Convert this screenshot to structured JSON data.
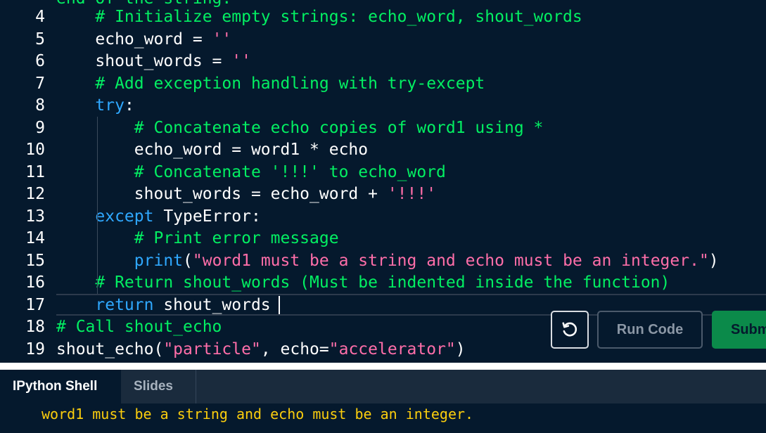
{
  "editor": {
    "partial_top_line": "end of the string.",
    "lines": [
      {
        "num": "4",
        "segs": [
          {
            "t": "    ",
            "c": "pl"
          },
          {
            "t": "# Initialize empty strings: echo_word, shout_words",
            "c": "cm"
          }
        ]
      },
      {
        "num": "5",
        "segs": [
          {
            "t": "    echo_word = ",
            "c": "pl"
          },
          {
            "t": "''",
            "c": "st"
          }
        ]
      },
      {
        "num": "6",
        "segs": [
          {
            "t": "    shout_words = ",
            "c": "pl"
          },
          {
            "t": "''",
            "c": "st"
          }
        ]
      },
      {
        "num": "7",
        "segs": [
          {
            "t": "    ",
            "c": "pl"
          },
          {
            "t": "# Add exception handling with try-except",
            "c": "cm"
          }
        ]
      },
      {
        "num": "8",
        "segs": [
          {
            "t": "    ",
            "c": "pl"
          },
          {
            "t": "try",
            "c": "kw"
          },
          {
            "t": ":",
            "c": "pl"
          }
        ]
      },
      {
        "num": "9",
        "segs": [
          {
            "t": "        ",
            "c": "pl"
          },
          {
            "t": "# Concatenate echo copies of word1 using *",
            "c": "cm"
          }
        ]
      },
      {
        "num": "10",
        "segs": [
          {
            "t": "        echo_word = word1 * echo",
            "c": "pl"
          }
        ]
      },
      {
        "num": "11",
        "segs": [
          {
            "t": "        ",
            "c": "pl"
          },
          {
            "t": "# Concatenate '!!!' to echo_word",
            "c": "cm"
          }
        ]
      },
      {
        "num": "12",
        "segs": [
          {
            "t": "        shout_words = echo_word + ",
            "c": "pl"
          },
          {
            "t": "'!!!'",
            "c": "st"
          }
        ]
      },
      {
        "num": "13",
        "segs": [
          {
            "t": "    ",
            "c": "pl"
          },
          {
            "t": "except",
            "c": "kw"
          },
          {
            "t": " TypeError:",
            "c": "pl"
          }
        ]
      },
      {
        "num": "14",
        "segs": [
          {
            "t": "        ",
            "c": "pl"
          },
          {
            "t": "# Print error message",
            "c": "cm"
          }
        ]
      },
      {
        "num": "15",
        "segs": [
          {
            "t": "        ",
            "c": "pl"
          },
          {
            "t": "print",
            "c": "kw"
          },
          {
            "t": "(",
            "c": "pl"
          },
          {
            "t": "\"word1 must be a string and echo must be an integer.\"",
            "c": "st"
          },
          {
            "t": ")",
            "c": "pl"
          }
        ]
      },
      {
        "num": "16",
        "segs": [
          {
            "t": "    ",
            "c": "pl"
          },
          {
            "t": "# Return shout_words (Must be indented inside the function)",
            "c": "cm"
          }
        ]
      },
      {
        "num": "17",
        "segs": [
          {
            "t": "    ",
            "c": "pl"
          },
          {
            "t": "return",
            "c": "kw"
          },
          {
            "t": " shout_words",
            "c": "pl"
          }
        ]
      },
      {
        "num": "18",
        "segs": [
          {
            "t": "# Call shout_echo",
            "c": "cm"
          }
        ]
      },
      {
        "num": "19",
        "segs": [
          {
            "t": "shout_echo(",
            "c": "pl"
          },
          {
            "t": "\"particle\"",
            "c": "st"
          },
          {
            "t": ", echo=",
            "c": "pl"
          },
          {
            "t": "\"accelerator\"",
            "c": "st"
          },
          {
            "t": ")",
            "c": "pl"
          }
        ]
      }
    ]
  },
  "toolbar": {
    "reset_icon": "reset-icon",
    "run_label": "Run Code",
    "submit_label": "Submit Answer"
  },
  "tabs": {
    "shell_label": "IPython Shell",
    "slides_label": "Slides"
  },
  "shell": {
    "output": "word1 must be a string and echo must be an integer."
  },
  "colors": {
    "background": "#05192d",
    "comment": "#03ef62",
    "string": "#ff6ea9",
    "keyword": "#2fa8ff",
    "shell_output": "#fcce0d",
    "submit": "#0b8a4a"
  }
}
